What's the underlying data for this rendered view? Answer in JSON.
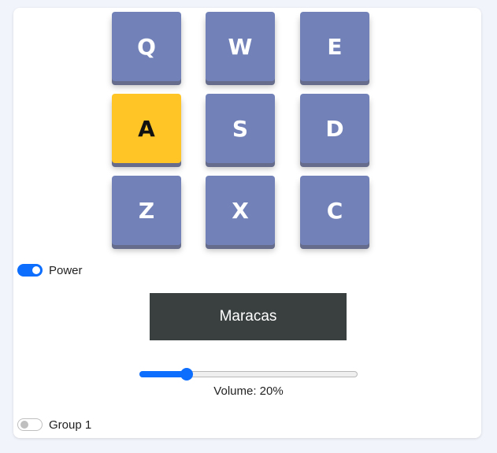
{
  "pads": [
    {
      "key": "Q",
      "active": false
    },
    {
      "key": "W",
      "active": false
    },
    {
      "key": "E",
      "active": false
    },
    {
      "key": "A",
      "active": true
    },
    {
      "key": "S",
      "active": false
    },
    {
      "key": "D",
      "active": false
    },
    {
      "key": "Z",
      "active": false
    },
    {
      "key": "X",
      "active": false
    },
    {
      "key": "C",
      "active": false
    }
  ],
  "power": {
    "label": "Power",
    "on": true
  },
  "display": {
    "text": "Maracas"
  },
  "volume": {
    "value": 0.2,
    "label": "Volume: 20%"
  },
  "bank": {
    "label": "Group 1",
    "on": false
  },
  "colors": {
    "pad": "#7282b8",
    "pad_active": "#ffc527",
    "display_bg": "#3a3f40",
    "accent": "#0d6efd"
  }
}
